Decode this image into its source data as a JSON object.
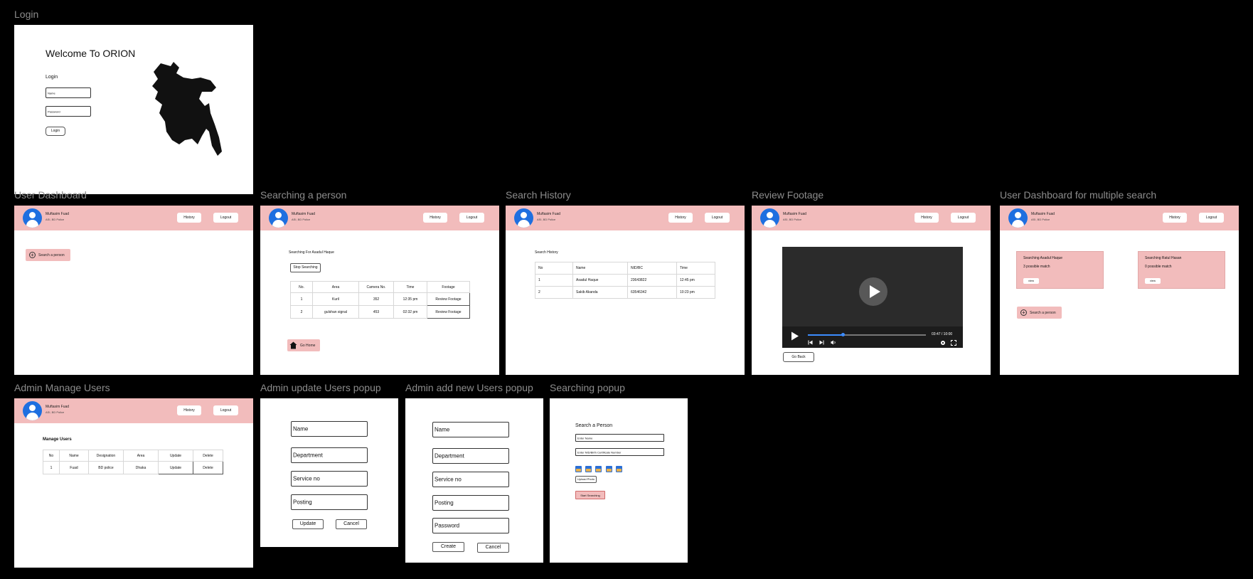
{
  "frames": {
    "login": "Login",
    "user_dashboard": "User Dashboard",
    "searching_person": "Searching a person",
    "search_history": "Search History",
    "review_footage": "Review Footage",
    "multi_search": "User Dashboard for multiple search",
    "admin_manage": "Admin Manage Users",
    "admin_update": "Admin update Users popup",
    "admin_add": "Admin add new Users popup",
    "searching_popup": "Searching popup"
  },
  "login": {
    "welcome": "Welcome To ORION",
    "heading": "Login",
    "name_placeholder": "Name",
    "password_placeholder": "Password",
    "button": "Login"
  },
  "header": {
    "user_name": "Muftasim Fuad",
    "user_role": "ASI, BD Police",
    "history": "History",
    "logout": "Logout"
  },
  "dashboard": {
    "search_button": "Search a person"
  },
  "searching": {
    "title": "Searching For Asadul Haque",
    "stop": "Stop Searching",
    "columns": [
      "No.",
      "Area",
      "Camera No.",
      "Time",
      "Footage"
    ],
    "rows": [
      {
        "no": "1",
        "area": "Kuril",
        "camera": "352",
        "time": "12:35 pm",
        "footage": "Review Footage"
      },
      {
        "no": "2",
        "area": "gulshan signal",
        "camera": "453",
        "time": "02:32 pm",
        "footage": "Review Footage"
      }
    ],
    "go_home": "Go Home"
  },
  "history": {
    "title": "Search History",
    "columns": [
      "No",
      "Name",
      "NID/BC",
      "Time"
    ],
    "rows": [
      {
        "no": "1",
        "name": "Asadul Haque",
        "nid": "23643822",
        "time": "12:45 pm"
      },
      {
        "no": "2",
        "name": "Sakib Akanda",
        "nid": "63546342",
        "time": "10:23 pm"
      }
    ]
  },
  "footage": {
    "time": "03:47 / 10:00",
    "progress": 0.3,
    "go_back": "Go Back"
  },
  "multi": {
    "cards": [
      {
        "title": "Searching Asadul Haque",
        "matches": "3 possible match",
        "view": "view"
      },
      {
        "title": "Searching Ratul Hasan",
        "matches": "0 possible match",
        "view": "view"
      }
    ],
    "search_button": "Search a person"
  },
  "manage": {
    "title": "Manage Users",
    "columns": [
      "No",
      "Name",
      "Designation",
      "Area",
      "Update",
      "Delete"
    ],
    "rows": [
      {
        "no": "1",
        "name": "Fuad",
        "designation": "BD police",
        "area": "Dhaka",
        "update": "Update",
        "delete": "Delete"
      }
    ]
  },
  "update_popup": {
    "fields": [
      "Name",
      "Department",
      "Service no",
      "Posting"
    ],
    "update": "Update",
    "cancel": "Cancel"
  },
  "add_popup": {
    "fields": [
      "Name",
      "Department",
      "Service no",
      "Posting",
      "Password"
    ],
    "create": "Create",
    "cancel": "Cancel"
  },
  "search_popup": {
    "title": "Search a Person",
    "name_placeholder": "Enter Name",
    "nid_placeholder": "Enter NID/Birth Certificate Number",
    "upload": "Upload Photo",
    "start": "Start Searching"
  },
  "colors": {
    "header_pink": "#f2bcbc",
    "avatar_blue": "#1e6fe0",
    "background": "#000000"
  }
}
